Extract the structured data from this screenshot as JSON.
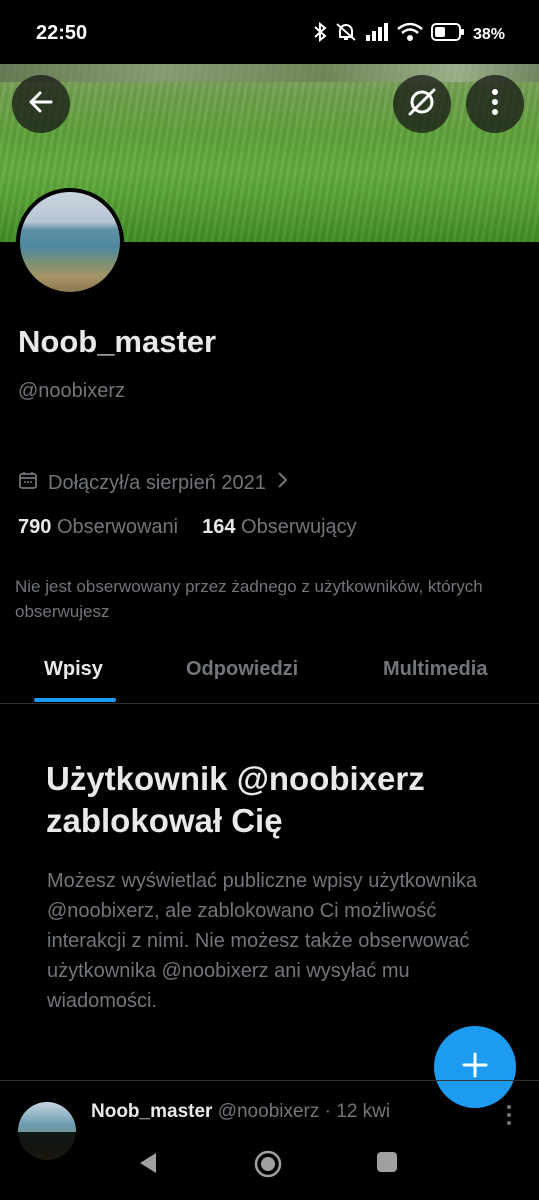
{
  "status_bar": {
    "time": "22:50",
    "battery": "38%",
    "icons": [
      "bluetooth-icon",
      "mute-icon",
      "signal-icon",
      "wifi-icon",
      "battery-icon"
    ]
  },
  "header": {
    "back_icon": "arrow-left-icon",
    "grok_icon": "grok-icon",
    "more_icon": "more-vertical-icon"
  },
  "profile": {
    "display_name": "Noob_master",
    "handle": "@noobixerz",
    "joined": "Dołączył/a sierpień 2021",
    "following_count": "790",
    "following_label": "Obserwowani",
    "followers_count": "164",
    "followers_label": "Obserwujący",
    "not_followed_note": "Nie jest obserwowany przez żadnego z użytkowników, których obserwujesz"
  },
  "tabs": [
    {
      "label": "Wpisy",
      "active": true
    },
    {
      "label": "Odpowiedzi",
      "active": false
    },
    {
      "label": "Multimedia",
      "active": false
    }
  ],
  "blocked": {
    "title": "Użytkownik @noobixerz zablokował Cię",
    "description": "Możesz wyświetlać publiczne wpisy użytkownika @noobixerz, ale zablokowano Ci możliwość interakcji z nimi. Nie możesz także obserwować użytkownika @noobixerz ani wysyłać mu wiadomości."
  },
  "post": {
    "author": "Noob_master",
    "handle_time": "@noobixerz · 12 kwi"
  },
  "fab": {
    "icon": "plus-icon"
  },
  "colors": {
    "accent": "#1d9bf0",
    "background": "#000000",
    "text_primary": "#e7e9ea",
    "text_secondary": "#71767b"
  }
}
